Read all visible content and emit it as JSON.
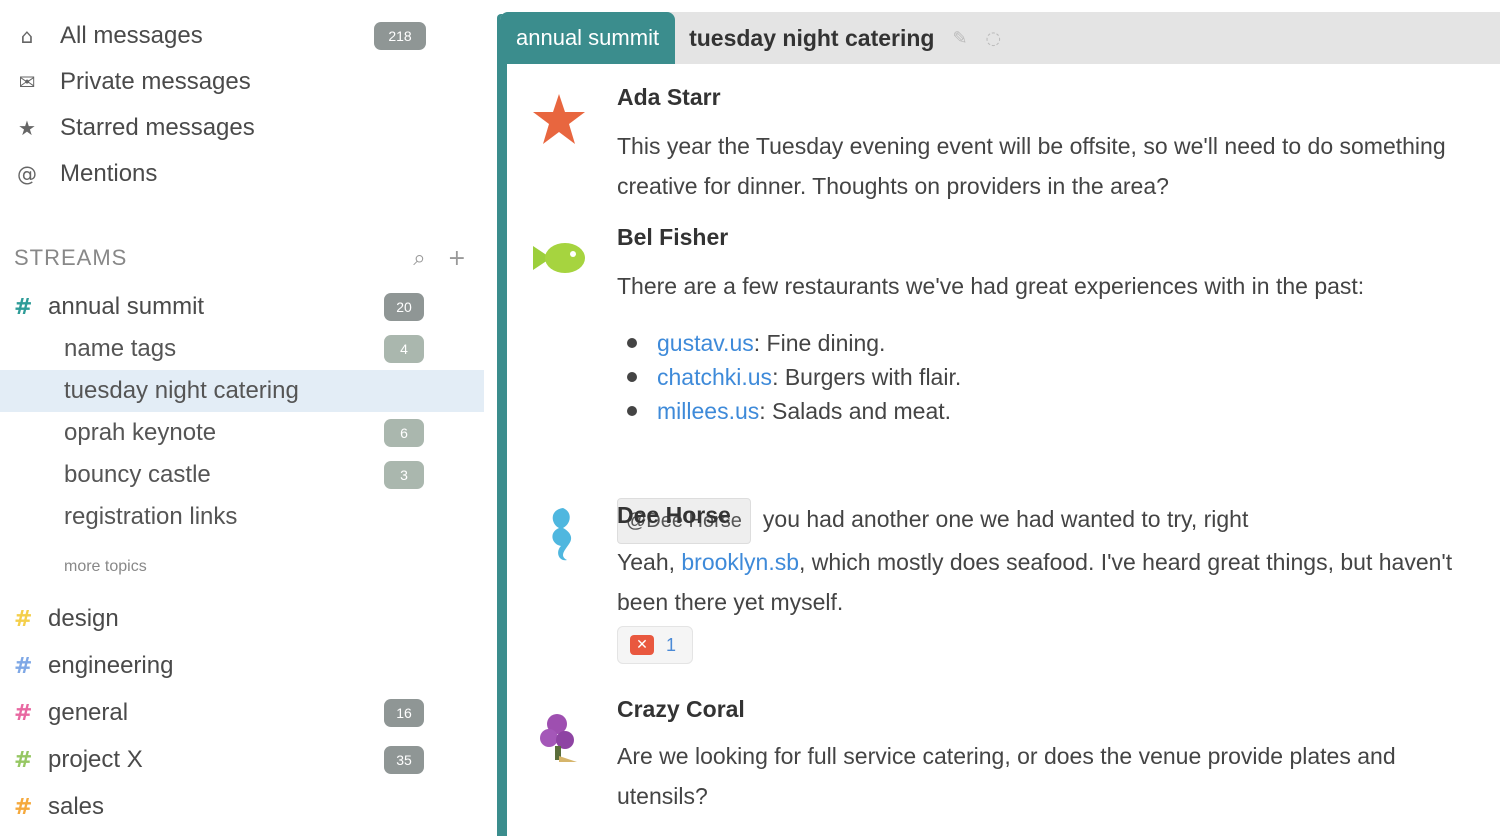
{
  "sidebar": {
    "nav": [
      {
        "label": "All messages",
        "icon": "home-icon",
        "badge": "218"
      },
      {
        "label": "Private messages",
        "icon": "envelope-icon",
        "badge": ""
      },
      {
        "label": "Starred messages",
        "icon": "star-icon",
        "badge": ""
      },
      {
        "label": "Mentions",
        "icon": "at-icon",
        "badge": ""
      }
    ],
    "streams_title": "STREAMS",
    "streams_actions": {
      "search_icon": "search-icon",
      "add_icon": "plus-icon"
    },
    "streams": [
      {
        "name": "annual summit",
        "color": "#2e9c98",
        "badge": "20"
      },
      {
        "name": "design",
        "color": "#f4cf4b",
        "badge": ""
      },
      {
        "name": "engineering",
        "color": "#7fa8e6",
        "badge": ""
      },
      {
        "name": "general",
        "color": "#e868a1",
        "badge": "16"
      },
      {
        "name": "project X",
        "color": "#96c763",
        "badge": "35"
      },
      {
        "name": "sales",
        "color": "#f5a93d",
        "badge": ""
      }
    ],
    "topics": [
      {
        "name": "name tags",
        "badge": "4"
      },
      {
        "name": "tuesday night catering",
        "badge": ""
      },
      {
        "name": "oprah keynote",
        "badge": "6"
      },
      {
        "name": "bouncy castle",
        "badge": "3"
      },
      {
        "name": "registration links",
        "badge": ""
      }
    ],
    "more_topics": "more topics"
  },
  "header": {
    "stream": "annual summit",
    "topic": "tuesday night catering",
    "icons": [
      "edit-icon",
      "mute-icon"
    ]
  },
  "messages": [
    {
      "sender": "Ada Starr",
      "avatar": "orange-star-avatar",
      "text": "This year the Tuesday evening event will be offsite, so we'll need to do something creative for dinner. Thoughts on providers in the area?"
    },
    {
      "sender": "Bel Fisher",
      "avatar": "green-fish-avatar",
      "text": "There are a few restaurants we've had great experiences with in the past:",
      "list": [
        {
          "link": "gustav.us",
          "desc": ": Fine dining."
        },
        {
          "link": "chatchki.us",
          "desc": ": Burgers with flair."
        },
        {
          "link": "millees.us",
          "desc": ": Salads and meat."
        }
      ],
      "mention": "@Dee Horse",
      "after_mention": "you had another one we had wanted to try, right"
    },
    {
      "sender": "Dee Horse",
      "avatar": "blue-seahorse-avatar",
      "text_before": "Yeah, ",
      "link": "brooklyn.sb",
      "text_after": ", which mostly does seafood. I've heard great things, but haven't been there yet myself.",
      "reaction_icon": "x-emoji-icon",
      "reaction_count": "1"
    },
    {
      "sender": "Crazy Coral",
      "avatar": "purple-coral-avatar",
      "text": "Are we looking for full service catering, or does the venue provide plates and utensils?"
    }
  ]
}
